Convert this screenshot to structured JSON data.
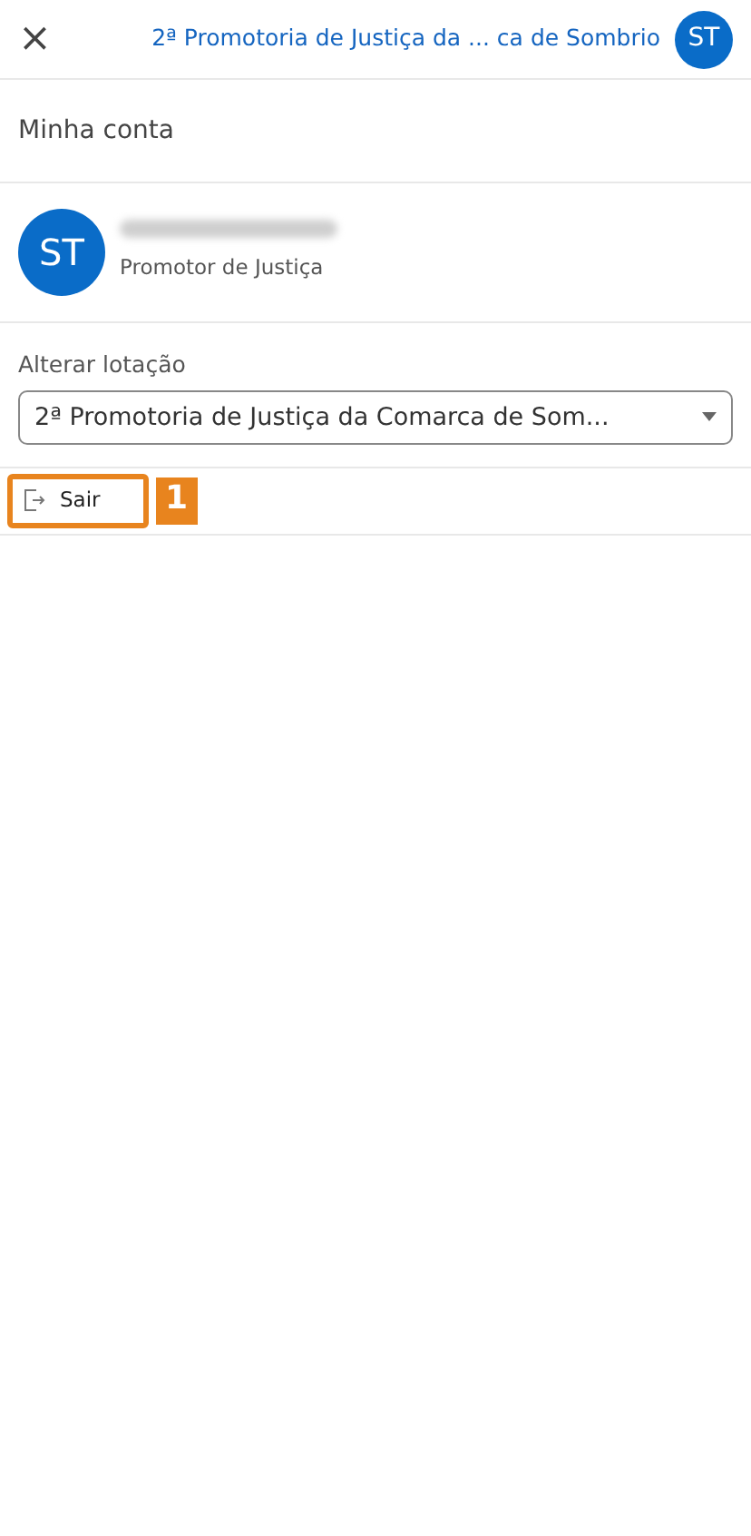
{
  "header": {
    "close_icon": "×",
    "title": "2ª Promotoria de Justiça da ...  ca de Sombrio",
    "avatar": "ST"
  },
  "section_title": "Minha conta",
  "profile": {
    "avatar": "ST",
    "role": "Promotor de Justiça"
  },
  "location": {
    "label": "Alterar lotação",
    "value": "2ª Promotoria de Justiça da Comarca de Som..."
  },
  "logout": {
    "label": "Sair",
    "highlighted": true,
    "callout": "1"
  }
}
